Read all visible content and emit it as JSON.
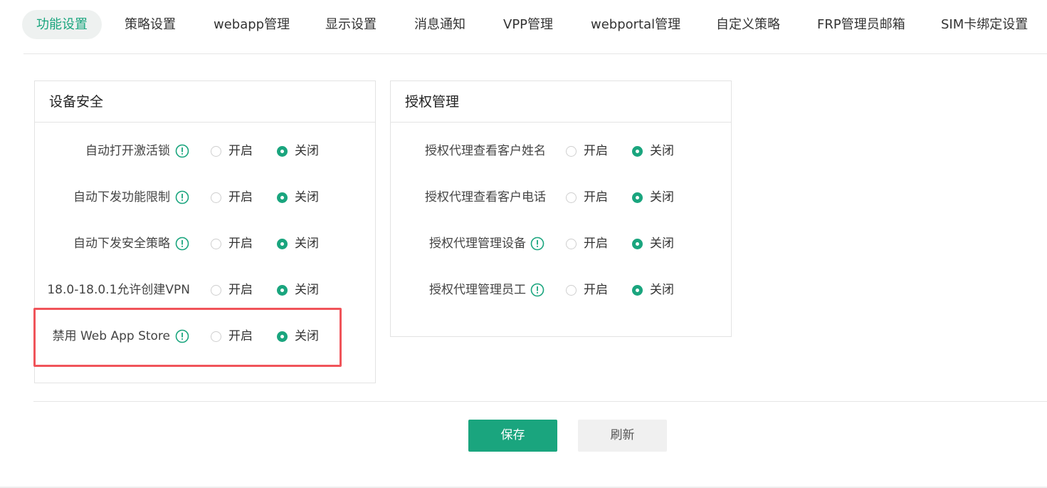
{
  "tabs": [
    {
      "label": "功能设置",
      "active": true
    },
    {
      "label": "策略设置"
    },
    {
      "label": "webapp管理"
    },
    {
      "label": "显示设置"
    },
    {
      "label": "消息通知"
    },
    {
      "label": "VPP管理"
    },
    {
      "label": "webportal管理"
    },
    {
      "label": "自定义策略"
    },
    {
      "label": "FRP管理员邮箱"
    },
    {
      "label": "SIM卡绑定设置"
    }
  ],
  "device_security": {
    "title": "设备安全",
    "rows": [
      {
        "label": "自动打开激活锁",
        "has_info": true,
        "on": "开启",
        "off": "关闭",
        "selected": "off"
      },
      {
        "label": "自动下发功能限制",
        "has_info": true,
        "on": "开启",
        "off": "关闭",
        "selected": "off"
      },
      {
        "label": "自动下发安全策略",
        "has_info": true,
        "on": "开启",
        "off": "关闭",
        "selected": "off"
      },
      {
        "label": "18.0-18.0.1允许创建VPN",
        "has_info": false,
        "on": "开启",
        "off": "关闭",
        "selected": "off"
      },
      {
        "label": "禁用 Web App Store",
        "has_info": true,
        "on": "开启",
        "off": "关闭",
        "selected": "off"
      }
    ]
  },
  "auth_management": {
    "title": "授权管理",
    "rows": [
      {
        "label": "授权代理查看客户姓名",
        "has_info": false,
        "on": "开启",
        "off": "关闭",
        "selected": "off"
      },
      {
        "label": "授权代理查看客户电话",
        "has_info": false,
        "on": "开启",
        "off": "关闭",
        "selected": "off"
      },
      {
        "label": "授权代理管理设备",
        "has_info": true,
        "on": "开启",
        "off": "关闭",
        "selected": "off"
      },
      {
        "label": "授权代理管理员工",
        "has_info": true,
        "on": "开启",
        "off": "关闭",
        "selected": "off"
      }
    ]
  },
  "actions": {
    "save_label": "保存",
    "refresh_label": "刷新"
  },
  "colors": {
    "accent": "#1aa57e",
    "highlight_border": "#f0545a"
  },
  "icons": {
    "info": "info-circle-icon"
  }
}
